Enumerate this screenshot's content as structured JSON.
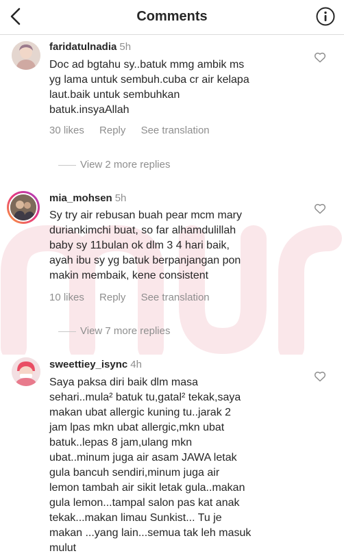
{
  "header": {
    "title": "Comments",
    "back_icon": "chevron-left-icon",
    "info_icon": "info-icon"
  },
  "comments": [
    {
      "username": "faridatulnadia",
      "time": "5h",
      "text": "Doc ad bgtahu sy..batuk mmg ambik ms\nyg lama untuk sembuh.cuba cr air kelapa\nlaut.baik untuk sembuhkan\nbatuk.insyaAllah",
      "likes": "30 likes",
      "reply": "Reply",
      "translate": "See translation",
      "more_replies": "View 2 more replies"
    },
    {
      "username": "mia_mohsen",
      "time": "5h",
      "text": "Sy try air rebusan buah pear mcm mary\nduriankimchi buat, so far alhamdulillah\nbaby sy 11bulan ok dlm 3 4 hari baik,\nayah ibu sy yg batuk berpanjangan pon\nmakin membaik, kene consistent",
      "likes": "10 likes",
      "reply": "Reply",
      "translate": "See translation",
      "more_replies": "View 7 more replies"
    },
    {
      "username": "sweettiey_isync",
      "time": "4h",
      "text": "Saya paksa diri baik dlm masa\nsehari..mula² batuk tu,gatal² tekak,saya\nmakan ubat allergic kuning tu..jarak 2\njam lpas mkn ubat allergic,mkn ubat\nbatuk..lepas 8 jam,ulang mkn\nubat..minum juga air asam JAWA letak\ngula bancuh sendiri,minum juga air\nlemon tambah air sikit letak gula..makan\ngula lemon...tampal salon pas kat anak\ntekak...makan limau Sunkist... Tu je\nmakan ...yang lain...semua tak leh masuk\nmulut"
    }
  ],
  "colors": {
    "text": "#262626",
    "secondary": "#8e8e8e",
    "divider": "#dbdbdb"
  }
}
